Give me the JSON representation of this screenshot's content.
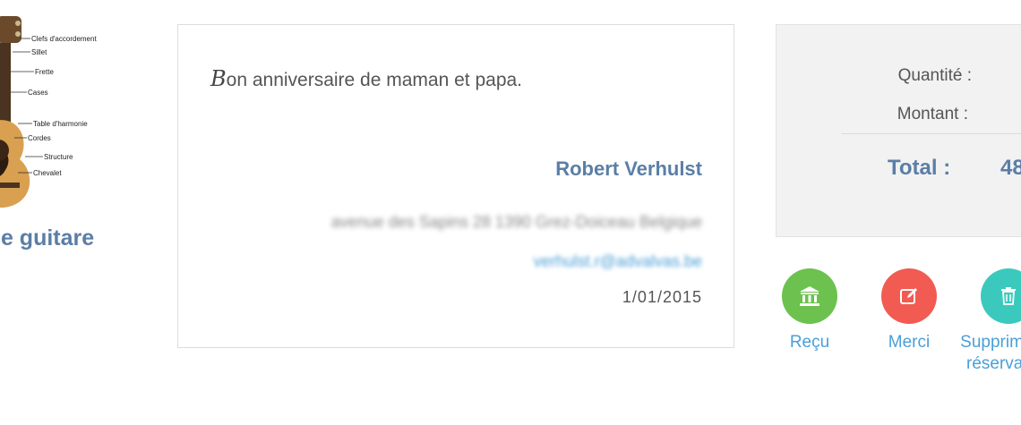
{
  "product": {
    "title": "le guitare",
    "diagram_labels": [
      "Clefs d'accordement",
      "Sillet",
      "Frette",
      "Cases",
      "Table d'harmonie",
      "Cordes",
      "Structure",
      "Chevalet"
    ]
  },
  "donation": {
    "message_initial": "B",
    "message_rest": "on anniversaire de maman et papa.",
    "donor_name": "Robert Verhulst",
    "address": "avenue des Sapins 28 1390 Grez-Doiceau Belgique",
    "email": "verhulst.r@advalvas.be",
    "date": "1/01/2015"
  },
  "totals": {
    "quantity_label": "Quantité :",
    "amount_label": "Montant :",
    "total_label": "Total :",
    "total_value": "48"
  },
  "actions": {
    "receipt": {
      "label": "Reçu",
      "icon": "bank-icon",
      "color": "#6cc14f"
    },
    "thanks": {
      "label": "Merci",
      "icon": "edit-icon",
      "color": "#f25b52"
    },
    "delete": {
      "label": "Supprimer la réservation",
      "icon": "trash-icon",
      "color": "#3cc9bd"
    }
  },
  "colors": {
    "accent_blue": "#5b7ea6",
    "link_blue": "#4a9fd6"
  }
}
